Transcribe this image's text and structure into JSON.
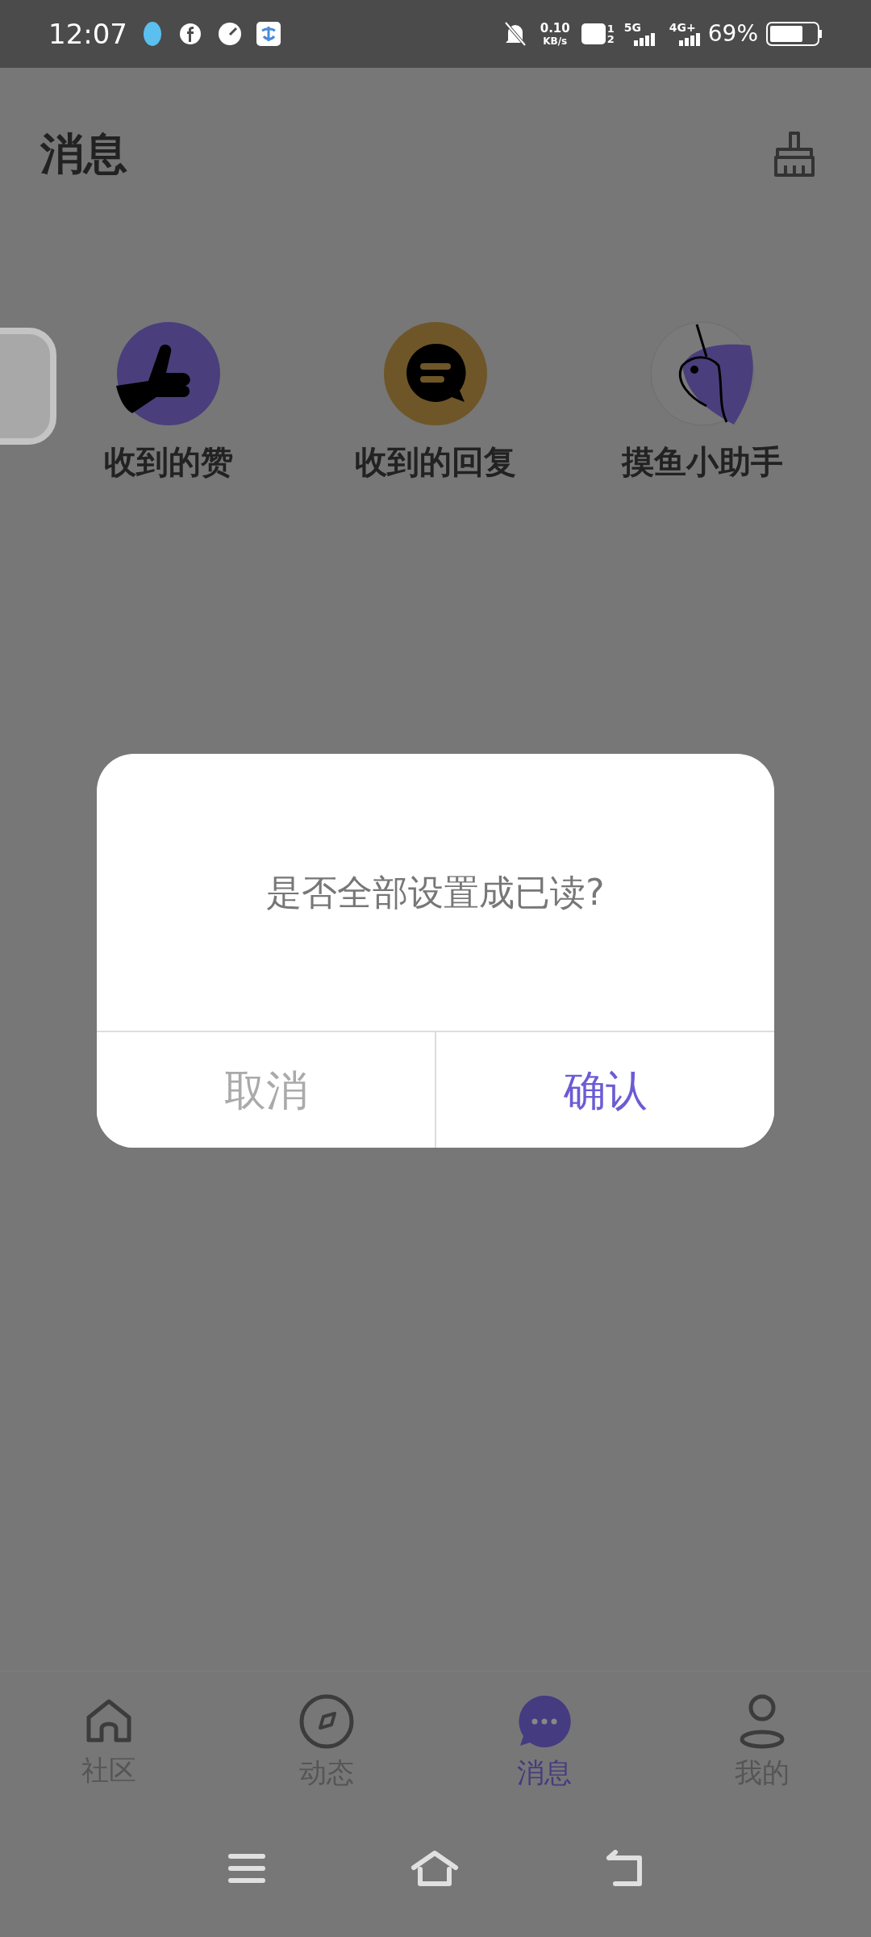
{
  "status_bar": {
    "time": "12:07",
    "net_speed": "0.10",
    "net_unit": "KB/s",
    "hd_sim_1": "1",
    "hd_sim_2": "2",
    "signal_1": "5G",
    "signal_2": "4G+",
    "battery": "69%"
  },
  "header": {
    "title": "消息"
  },
  "shortcuts": [
    {
      "kind": "likes",
      "label": "收到的赞"
    },
    {
      "kind": "replies",
      "label": "收到的回复"
    },
    {
      "kind": "assistant",
      "label": "摸鱼小助手"
    }
  ],
  "dialog": {
    "message": "是否全部设置成已读?",
    "buttons": [
      {
        "kind": "cancel",
        "label": "取消"
      },
      {
        "kind": "confirm",
        "label": "确认"
      }
    ]
  },
  "tabs": [
    {
      "kind": "home",
      "label": "社区",
      "selected": false
    },
    {
      "kind": "compass",
      "label": "动态",
      "selected": false
    },
    {
      "kind": "chat",
      "label": "消息",
      "selected": true
    },
    {
      "kind": "person",
      "label": "我的",
      "selected": false
    }
  ]
}
